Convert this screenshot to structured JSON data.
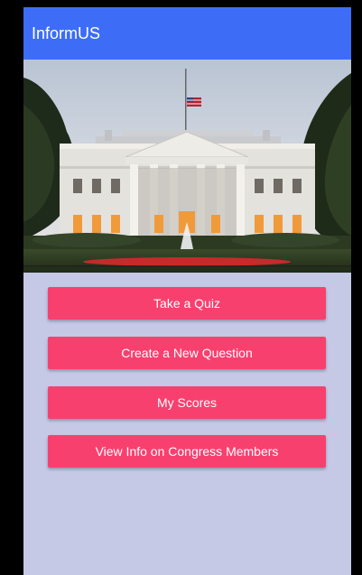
{
  "app_bar": {
    "title": "InformUS",
    "color": "#3d6df7"
  },
  "hero": {
    "description_icon": "white-house-photo"
  },
  "menu": {
    "button_color": "#f8406f",
    "items": [
      {
        "label": "Take a Quiz"
      },
      {
        "label": "Create a New Question"
      },
      {
        "label": "My Scores"
      },
      {
        "label": "View Info on Congress Members"
      }
    ]
  },
  "background_color": "#c5c9e6"
}
